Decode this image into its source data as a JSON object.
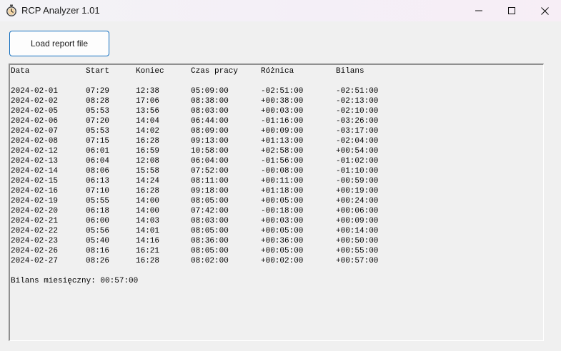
{
  "window": {
    "title": "RCP Analyzer 1.01",
    "icon": "stopwatch-icon"
  },
  "toolbar": {
    "load_label": "Load report file"
  },
  "report": {
    "headers": [
      "Data",
      "Start",
      "Koniec",
      "Czas pracy",
      "Różnica",
      "Bilans"
    ],
    "rows": [
      [
        "2024-02-01",
        "07:29",
        "12:38",
        "05:09:00",
        "-02:51:00",
        "-02:51:00"
      ],
      [
        "2024-02-02",
        "08:28",
        "17:06",
        "08:38:00",
        "+00:38:00",
        "-02:13:00"
      ],
      [
        "2024-02-05",
        "05:53",
        "13:56",
        "08:03:00",
        "+00:03:00",
        "-02:10:00"
      ],
      [
        "2024-02-06",
        "07:20",
        "14:04",
        "06:44:00",
        "-01:16:00",
        "-03:26:00"
      ],
      [
        "2024-02-07",
        "05:53",
        "14:02",
        "08:09:00",
        "+00:09:00",
        "-03:17:00"
      ],
      [
        "2024-02-08",
        "07:15",
        "16:28",
        "09:13:00",
        "+01:13:00",
        "-02:04:00"
      ],
      [
        "2024-02-12",
        "06:01",
        "16:59",
        "10:58:00",
        "+02:58:00",
        "+00:54:00"
      ],
      [
        "2024-02-13",
        "06:04",
        "12:08",
        "06:04:00",
        "-01:56:00",
        "-01:02:00"
      ],
      [
        "2024-02-14",
        "08:06",
        "15:58",
        "07:52:00",
        "-00:08:00",
        "-01:10:00"
      ],
      [
        "2024-02-15",
        "06:13",
        "14:24",
        "08:11:00",
        "+00:11:00",
        "-00:59:00"
      ],
      [
        "2024-02-16",
        "07:10",
        "16:28",
        "09:18:00",
        "+01:18:00",
        "+00:19:00"
      ],
      [
        "2024-02-19",
        "05:55",
        "14:00",
        "08:05:00",
        "+00:05:00",
        "+00:24:00"
      ],
      [
        "2024-02-20",
        "06:18",
        "14:00",
        "07:42:00",
        "-00:18:00",
        "+00:06:00"
      ],
      [
        "2024-02-21",
        "06:00",
        "14:03",
        "08:03:00",
        "+00:03:00",
        "+00:09:00"
      ],
      [
        "2024-02-22",
        "05:56",
        "14:01",
        "08:05:00",
        "+00:05:00",
        "+00:14:00"
      ],
      [
        "2024-02-23",
        "05:40",
        "14:16",
        "08:36:00",
        "+00:36:00",
        "+00:50:00"
      ],
      [
        "2024-02-26",
        "08:16",
        "16:21",
        "08:05:00",
        "+00:05:00",
        "+00:55:00"
      ],
      [
        "2024-02-27",
        "08:26",
        "16:28",
        "08:02:00",
        "+00:02:00",
        "+00:57:00"
      ]
    ],
    "summary": "Bilans miesięczny: 00:57:00"
  },
  "colors": {
    "accent_border": "#0f6cbd",
    "window_bg": "#f0f0f0"
  }
}
